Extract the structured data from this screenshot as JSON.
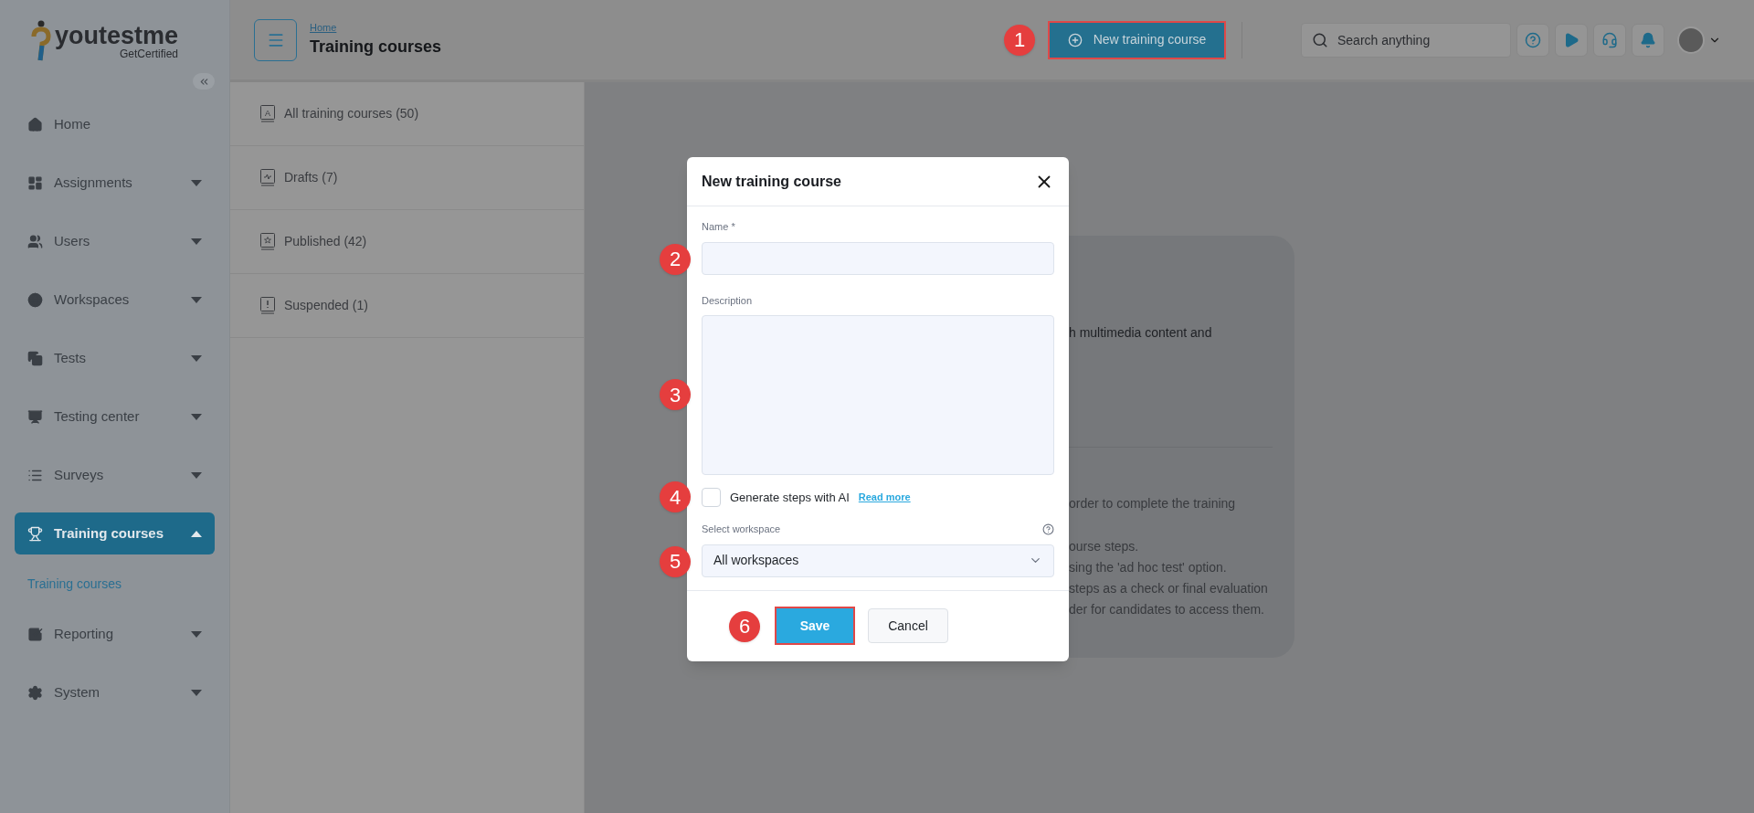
{
  "logo": {
    "name": "youtestme",
    "tagline": "GetCertified"
  },
  "sidebar": {
    "items": [
      {
        "label": "Home",
        "expandable": false,
        "selected": false
      },
      {
        "label": "Assignments",
        "expandable": true,
        "expanded": false,
        "selected": false
      },
      {
        "label": "Users",
        "expandable": true,
        "expanded": false,
        "selected": false
      },
      {
        "label": "Workspaces",
        "expandable": true,
        "expanded": false,
        "selected": false
      },
      {
        "label": "Tests",
        "expandable": true,
        "expanded": false,
        "selected": false
      },
      {
        "label": "Testing center",
        "expandable": true,
        "expanded": false,
        "selected": false
      },
      {
        "label": "Surveys",
        "expandable": true,
        "expanded": false,
        "selected": false
      },
      {
        "label": "Training courses",
        "expandable": true,
        "expanded": true,
        "selected": true,
        "children": [
          {
            "label": "Training courses",
            "selected": true
          }
        ]
      },
      {
        "label": "Reporting",
        "expandable": true,
        "expanded": false,
        "selected": false
      },
      {
        "label": "System",
        "expandable": true,
        "expanded": false,
        "selected": false
      }
    ]
  },
  "header": {
    "breadcrumb": "Home",
    "title": "Training courses",
    "new_button": {
      "label": "New training course",
      "marker": "1"
    },
    "search": {
      "placeholder": "Search anything"
    }
  },
  "course_filters": [
    {
      "label": "All training courses (50)",
      "icon_letter": "A"
    },
    {
      "label": "Drafts (7)"
    },
    {
      "label": "Published (42)"
    },
    {
      "label": "Suspended (1)"
    }
  ],
  "info_card": {
    "intro": "h multimedia content and",
    "lines": [
      "order to complete the training",
      "ourse steps.",
      "sing the 'ad hoc test' option.",
      "steps as a check or final evaluation",
      "der for candidates to access them."
    ]
  },
  "dialog": {
    "title": "New training course",
    "name_field": {
      "label": "Name *",
      "marker": "2"
    },
    "description_field": {
      "label": "Description",
      "marker": "3"
    },
    "ai_checkbox": {
      "label": "Generate steps with AI",
      "checked": false,
      "link": "Read more",
      "marker": "4"
    },
    "workspace_select": {
      "label": "Select workspace",
      "value": "All workspaces",
      "marker": "5"
    },
    "save_button": {
      "label": "Save",
      "marker": "6"
    },
    "cancel_button": {
      "label": "Cancel"
    }
  }
}
